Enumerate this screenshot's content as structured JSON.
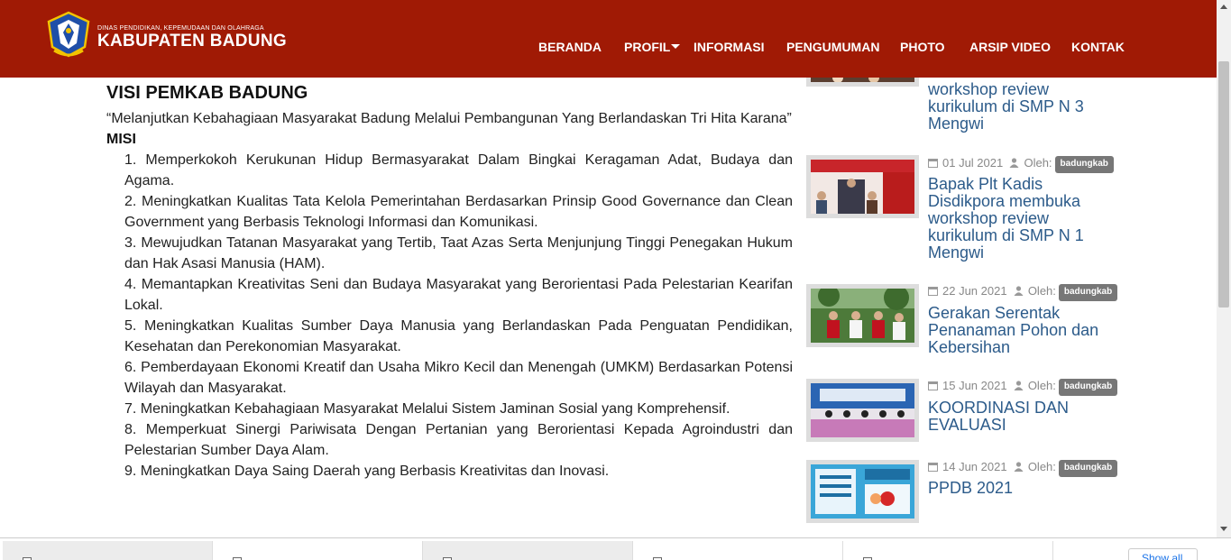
{
  "header": {
    "brand_small": "DINAS PENDIDIKAN, KEPEMUDAAN DAN OLAHRAGA",
    "brand_big": "KABUPATEN BADUNG",
    "logo_icon": "badung-crest-logo",
    "background_color": "#a01a05"
  },
  "nav": {
    "items": [
      "BERANDA",
      "PROFIL",
      "INFORMASI",
      "PENGUMUMAN",
      "PHOTO",
      "ARSIP VIDEO",
      "KONTAK"
    ]
  },
  "main": {
    "visi_title": "VISI PEMKAB BADUNG",
    "visi_text": "“Melanjutkan Kebahagiaan  Masyarakat  Badung  Melalui Pembangunan Yang Berlandaskan Tri Hita Karana”",
    "misi_title": "MISI",
    "misi_items": [
      "1.  Memperkokoh Kerukunan Hidup Bermasyarakat Dalam Bingkai Keragaman Adat, Budaya dan Agama.",
      "2. Meningkatkan Kualitas Tata Kelola Pemerintahan Berdasarkan Prinsip Good Governance dan Clean Government yang Berbasis Teknologi Informasi dan Komunikasi.",
      "3.  Mewujudkan Tatanan Masyarakat yang Tertib, Taat Azas Serta Menjunjung Tinggi Penegakan Hukum dan Hak Asasi Manusia (HAM).",
      "4.  Memantapkan Kreativitas Seni dan Budaya Masyarakat yang Berorientasi Pada Pelestarian Kearifan Lokal.",
      "5.  Meningkatkan Kualitas Sumber Daya Manusia yang Berlandaskan Pada Penguatan Pendidikan, Kesehatan dan Perekonomian Masyarakat.",
      "6.  Pemberdayaan Ekonomi Kreatif dan Usaha Mikro Kecil dan Menengah (UMKM) Berdasarkan Potensi Wilayah dan Masyarakat.",
      "7.  Meningkatkan Kebahagiaan Masyarakat Melalui Sistem Jaminan Sosial yang Komprehensif.",
      "8.  Memperkuat Sinergi Pariwisata Dengan Pertanian yang Berorientasi Kepada Agroindustri dan Pelestarian Sumber Daya Alam.",
      "9.  Meningkatkan Daya Saing Daerah yang Berbasis Kreativitas dan Inovasi."
    ]
  },
  "sidebar": {
    "by_label": "Oleh:",
    "posts": [
      {
        "title": "workshop review kurikulum di SMP N 3 Mengwi"
      },
      {
        "date": "01 Jul 2021",
        "author": "badungkab",
        "title": "Bapak Plt Kadis Disdikpora membuka workshop review kurikulum di SMP N 1 Mengwi"
      },
      {
        "date": "22 Jun 2021",
        "author": "badungkab",
        "title": "Gerakan Serentak Penanaman Pohon dan Kebersihan"
      },
      {
        "date": "15 Jun 2021",
        "author": "badungkab",
        "title": "KOORDINASI DAN EVALUASI"
      },
      {
        "date": "14 Jun 2021",
        "author": "badungkab",
        "title": "PPDB 2021"
      }
    ]
  },
  "downloads": {
    "show_all_label": "Show all",
    "item_icon": "file-icon"
  },
  "colors": {
    "link": "#2c5b8a",
    "badge": "#777777"
  }
}
